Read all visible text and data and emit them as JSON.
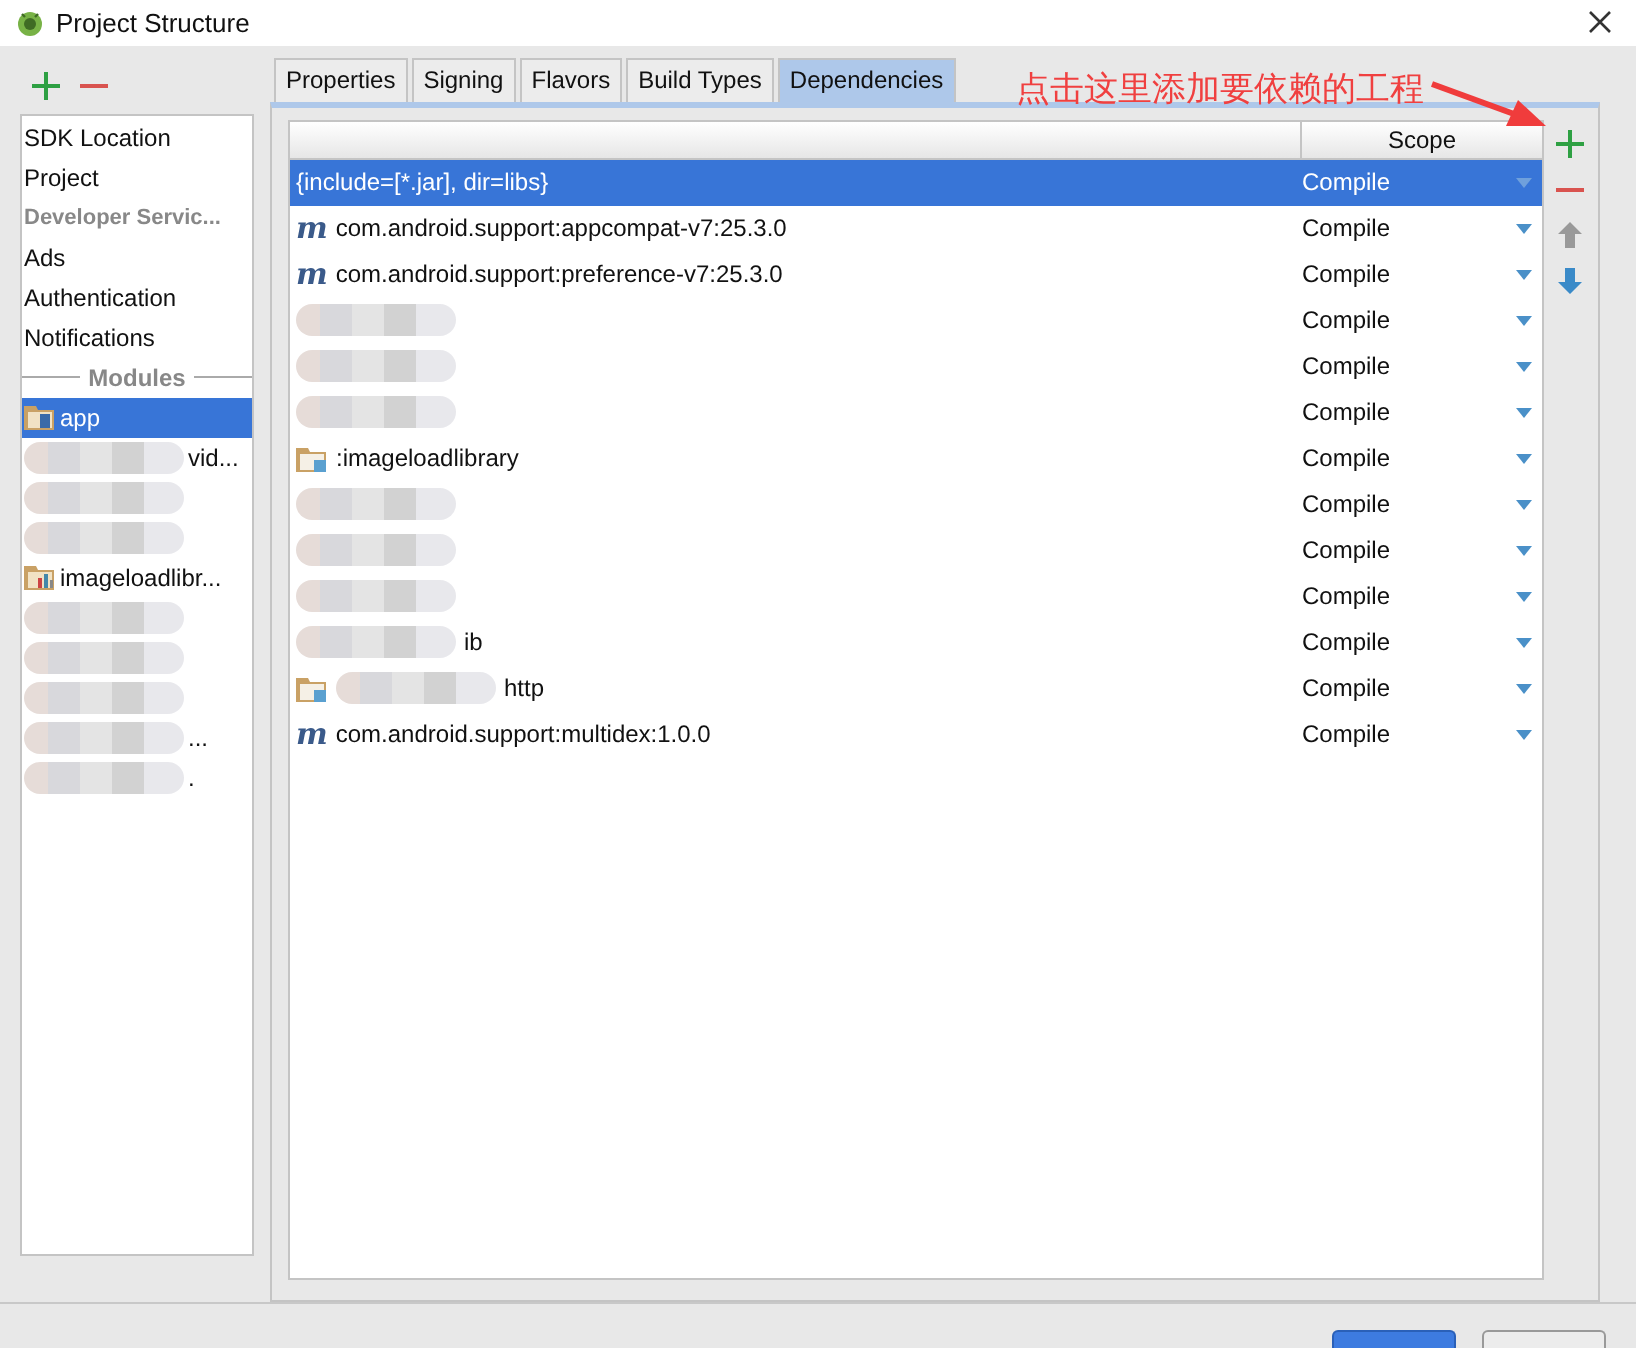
{
  "window": {
    "title": "Project Structure"
  },
  "sidebar": {
    "items": [
      {
        "kind": "item",
        "label": "SDK Location",
        "selected": false
      },
      {
        "kind": "item",
        "label": "Project",
        "selected": false
      },
      {
        "kind": "header",
        "label": "Developer Servic..."
      },
      {
        "kind": "item",
        "label": "Ads",
        "selected": false
      },
      {
        "kind": "item",
        "label": "Authentication",
        "selected": false
      },
      {
        "kind": "item",
        "label": "Notifications",
        "selected": false
      },
      {
        "kind": "separator",
        "label": "Modules"
      },
      {
        "kind": "module",
        "label": "app",
        "selected": true,
        "redacted": false
      },
      {
        "kind": "module",
        "label": "vid...",
        "selected": false,
        "redacted": true
      },
      {
        "kind": "module",
        "selected": false,
        "redacted": true
      },
      {
        "kind": "module",
        "selected": false,
        "redacted": true
      },
      {
        "kind": "module",
        "label": "imageloadlibr...",
        "selected": false,
        "redacted": false
      },
      {
        "kind": "module",
        "selected": false,
        "redacted": true
      },
      {
        "kind": "module",
        "selected": false,
        "redacted": true
      },
      {
        "kind": "module",
        "selected": false,
        "redacted": true
      },
      {
        "kind": "module",
        "label": "...",
        "selected": false,
        "redacted": true
      },
      {
        "kind": "module",
        "label": ".",
        "selected": false,
        "redacted": true
      }
    ]
  },
  "tabs": [
    {
      "label": "Properties",
      "selected": false
    },
    {
      "label": "Signing",
      "selected": false
    },
    {
      "label": "Flavors",
      "selected": false
    },
    {
      "label": "Build Types",
      "selected": false
    },
    {
      "label": "Dependencies",
      "selected": true
    }
  ],
  "annotation": {
    "text": "点击这里添加要依赖的工程"
  },
  "table": {
    "columns": [
      "Scope"
    ],
    "rows": [
      {
        "kind": "jar",
        "text": "{include=[*.jar], dir=libs}",
        "scope": "Compile",
        "selected": true,
        "redacted": false
      },
      {
        "kind": "maven",
        "icon_text": "m",
        "text": "com.android.support:appcompat-v7:25.3.0",
        "scope": "Compile",
        "selected": false,
        "redacted": false
      },
      {
        "kind": "maven",
        "icon_text": "m",
        "text": "com.android.support:preference-v7:25.3.0",
        "scope": "Compile",
        "selected": false,
        "redacted": false
      },
      {
        "scope": "Compile",
        "selected": false,
        "redacted": true
      },
      {
        "scope": "Compile",
        "selected": false,
        "redacted": true
      },
      {
        "scope": "Compile",
        "selected": false,
        "redacted": true
      },
      {
        "kind": "module",
        "text": ":imageloadlibrary",
        "scope": "Compile",
        "selected": false,
        "redacted": false
      },
      {
        "scope": "Compile",
        "selected": false,
        "redacted": true
      },
      {
        "scope": "Compile",
        "selected": false,
        "redacted": true
      },
      {
        "scope": "Compile",
        "selected": false,
        "redacted": true
      },
      {
        "text": "ib",
        "scope": "Compile",
        "selected": false,
        "redacted": true
      },
      {
        "kind": "module",
        "text": "http",
        "scope": "Compile",
        "selected": false,
        "redacted": true
      },
      {
        "kind": "maven",
        "icon_text": "m",
        "text": "com.android.support:multidex:1.0.0",
        "scope": "Compile",
        "selected": false,
        "redacted": false
      }
    ]
  },
  "toolbar": {
    "buttons": [
      {
        "kind": "add",
        "disabled": false
      },
      {
        "kind": "remove",
        "disabled": false
      },
      {
        "kind": "up",
        "disabled": true
      },
      {
        "kind": "down",
        "disabled": false
      }
    ]
  }
}
